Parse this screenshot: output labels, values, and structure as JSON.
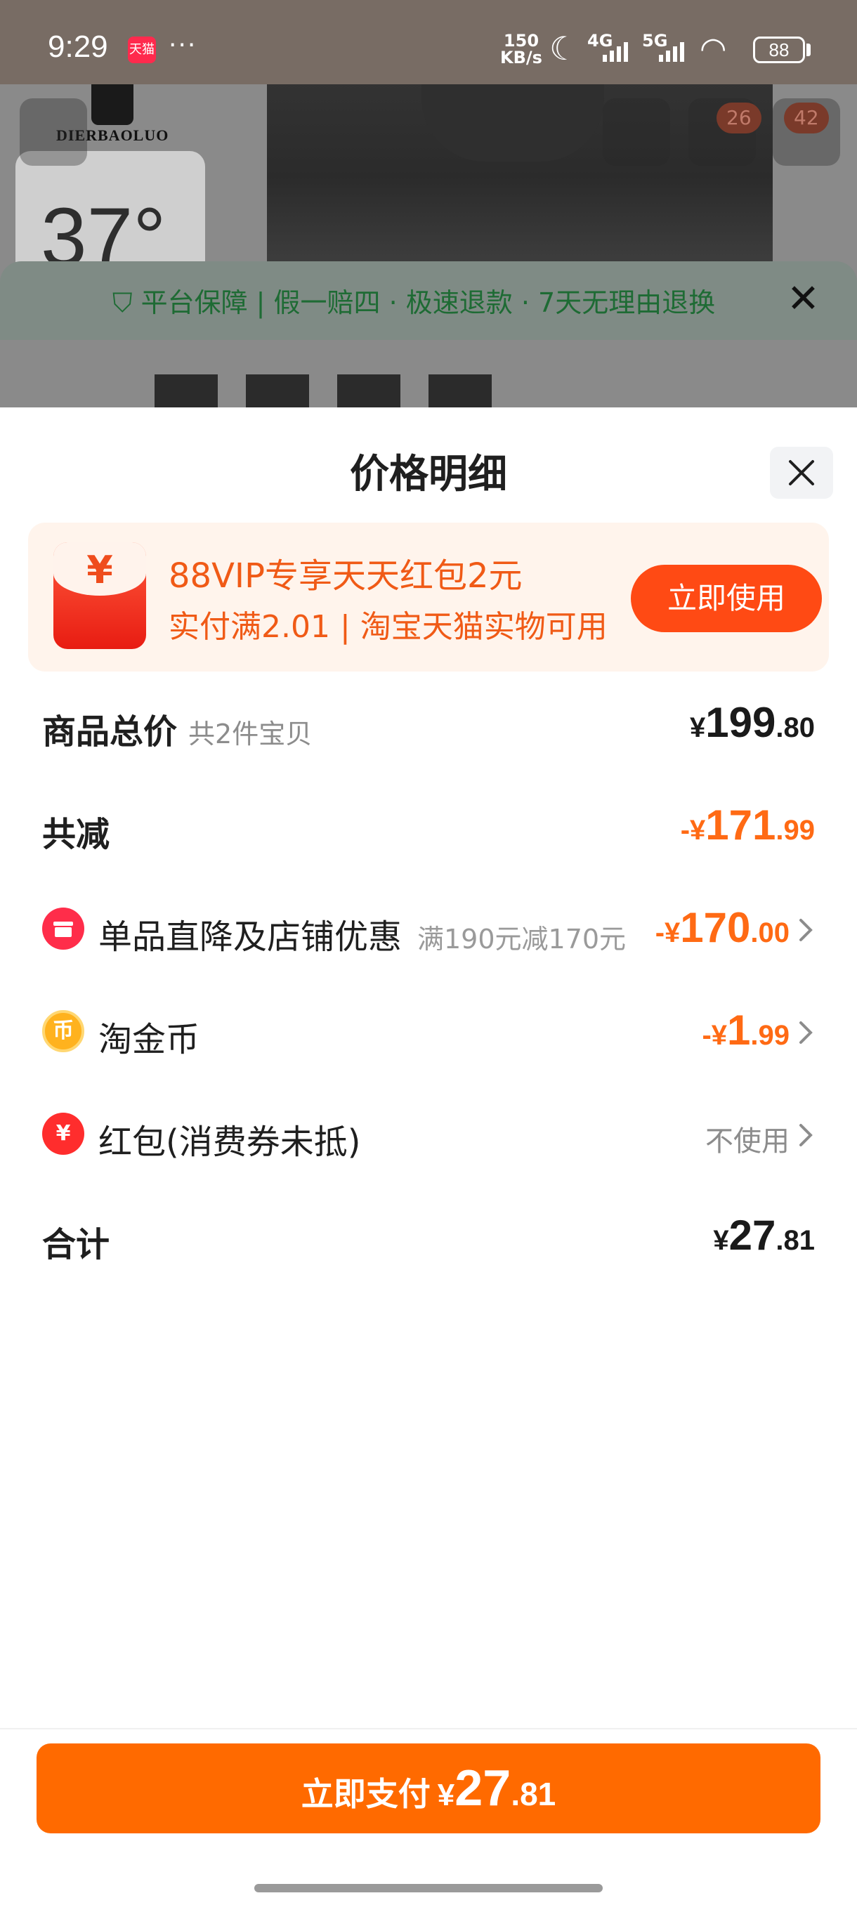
{
  "status_bar": {
    "time": "9:29",
    "app_badge": "天猫",
    "more": "···",
    "speed_value": "150",
    "speed_unit": "KB/s",
    "net1": "4G",
    "net2": "5G",
    "battery": "88"
  },
  "background": {
    "logo_text": "DIERBAOLUO",
    "weather_text": "37°",
    "cart_badge": "26",
    "msg_badge": "42",
    "guarantee_text": "平台保障 | 假一赔四 · 极速退款 · 7天无理由退换"
  },
  "sheet": {
    "title": "价格明细"
  },
  "promo": {
    "icon_symbol": "¥",
    "title": "88VIP专享天天红包2元",
    "subtitle": "实付满2.01 | 淘宝天猫实物可用",
    "button": "立即使用"
  },
  "rows": {
    "total": {
      "label": "商品总价",
      "sub": "共2件宝贝",
      "yen": "¥",
      "int": "199",
      "dec": ".80"
    },
    "reduce": {
      "label": "共减",
      "prefix": "-¥",
      "int": "171",
      "dec": ".99"
    },
    "store": {
      "label": "单品直降及店铺优惠",
      "note": "满190元减170元",
      "prefix": "-¥",
      "int": "170",
      "dec": ".00"
    },
    "coins": {
      "icon_symbol": "币",
      "label": "淘金币",
      "prefix": "-¥",
      "int": "1",
      "dec": ".99"
    },
    "redpacket": {
      "icon_symbol": "¥",
      "label": "红包(消费券未抵)",
      "value": "不使用"
    },
    "sum": {
      "label": "合计",
      "yen": "¥",
      "int": "27",
      "dec": ".81"
    }
  },
  "pay": {
    "label": "立即支付",
    "yen": "¥",
    "int": "27",
    "dec": ".81"
  },
  "colors": {
    "accent_orange": "#ff6a00",
    "promo_text": "#f05a16",
    "discount_orange": "#ff6a14",
    "guarantee_green": "#1e6b34"
  }
}
